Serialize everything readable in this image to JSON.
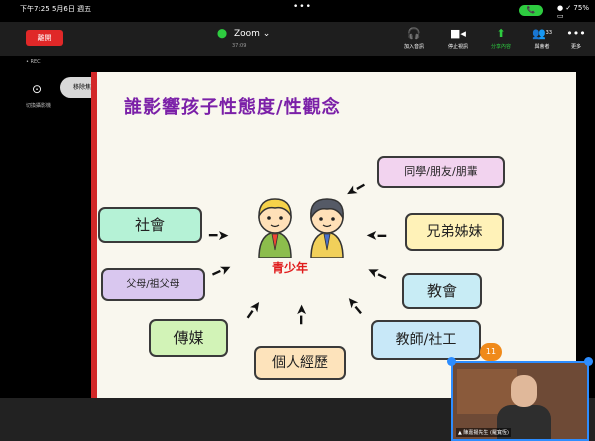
{
  "status": {
    "time": "下午7:25  5月6日 週五",
    "dots": "•••",
    "call": "📞",
    "battery": "● ✓ 75% ▭"
  },
  "topbar": {
    "leave": "離開",
    "title": "Zoom",
    "title_caret": "⌄",
    "subtitle": "37:09",
    "tools": [
      {
        "icon": "🎧",
        "label": "加入音訊"
      },
      {
        "icon": "■◂",
        "label": "停止視訊"
      },
      {
        "icon": "⬆",
        "label": "分享內容"
      },
      {
        "icon": "👥",
        "label": "與會者",
        "count": "33"
      },
      {
        "icon": "•••",
        "label": "更多"
      }
    ]
  },
  "left": {
    "rec": "• REC",
    "camera_icon": "⊙",
    "camera_label": "切換攝影機",
    "move_button": "移除焦點視訊"
  },
  "slide": {
    "title": "誰影響孩子性態度/性觀念",
    "center": "青少年",
    "boxes": [
      {
        "key": "society",
        "text": "社會",
        "color": "#b5f2d6"
      },
      {
        "key": "parents",
        "text": "父母/祖父母",
        "color": "#d9c7ef"
      },
      {
        "key": "media",
        "text": "傳媒",
        "color": "#d2f3b7"
      },
      {
        "key": "experience",
        "text": "個人經歷",
        "color": "#fde3bb"
      },
      {
        "key": "peers",
        "text": "同學/朋友/朋輩",
        "color": "#f2d3ef"
      },
      {
        "key": "siblings",
        "text": "兄弟姊妹",
        "color": "#fff2b8"
      },
      {
        "key": "religion",
        "text": "教會",
        "color": "#c8ecf5"
      },
      {
        "key": "teachers",
        "text": "教師/社工",
        "color": "#c8e8f8"
      }
    ]
  },
  "participants": {
    "count_badge": "11",
    "video_name": "▲ 陳嘉揚先生 (羅寬恆)"
  }
}
